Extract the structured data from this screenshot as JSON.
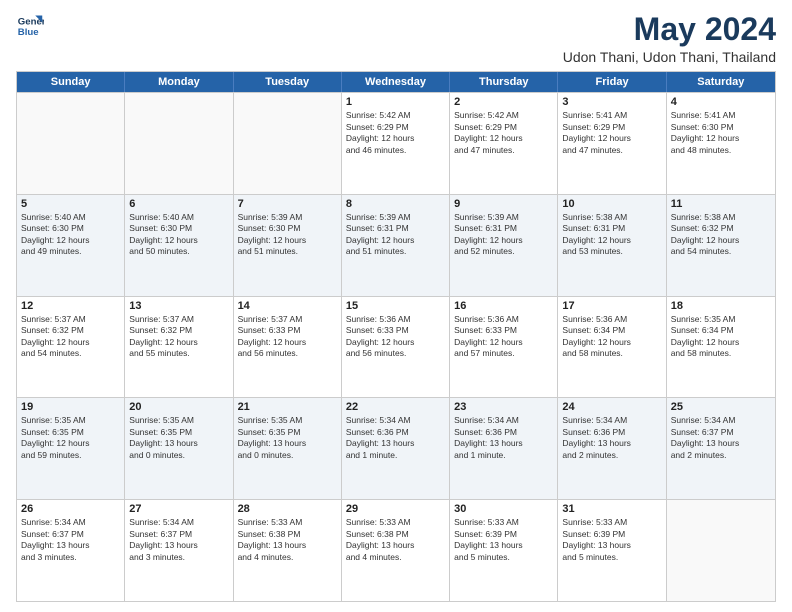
{
  "logo": {
    "line1": "General",
    "line2": "Blue"
  },
  "title": "May 2024",
  "subtitle": "Udon Thani, Udon Thani, Thailand",
  "days": [
    "Sunday",
    "Monday",
    "Tuesday",
    "Wednesday",
    "Thursday",
    "Friday",
    "Saturday"
  ],
  "weeks": [
    [
      {
        "day": "",
        "text": ""
      },
      {
        "day": "",
        "text": ""
      },
      {
        "day": "",
        "text": ""
      },
      {
        "day": "1",
        "text": "Sunrise: 5:42 AM\nSunset: 6:29 PM\nDaylight: 12 hours\nand 46 minutes."
      },
      {
        "day": "2",
        "text": "Sunrise: 5:42 AM\nSunset: 6:29 PM\nDaylight: 12 hours\nand 47 minutes."
      },
      {
        "day": "3",
        "text": "Sunrise: 5:41 AM\nSunset: 6:29 PM\nDaylight: 12 hours\nand 47 minutes."
      },
      {
        "day": "4",
        "text": "Sunrise: 5:41 AM\nSunset: 6:30 PM\nDaylight: 12 hours\nand 48 minutes."
      }
    ],
    [
      {
        "day": "5",
        "text": "Sunrise: 5:40 AM\nSunset: 6:30 PM\nDaylight: 12 hours\nand 49 minutes."
      },
      {
        "day": "6",
        "text": "Sunrise: 5:40 AM\nSunset: 6:30 PM\nDaylight: 12 hours\nand 50 minutes."
      },
      {
        "day": "7",
        "text": "Sunrise: 5:39 AM\nSunset: 6:30 PM\nDaylight: 12 hours\nand 51 minutes."
      },
      {
        "day": "8",
        "text": "Sunrise: 5:39 AM\nSunset: 6:31 PM\nDaylight: 12 hours\nand 51 minutes."
      },
      {
        "day": "9",
        "text": "Sunrise: 5:39 AM\nSunset: 6:31 PM\nDaylight: 12 hours\nand 52 minutes."
      },
      {
        "day": "10",
        "text": "Sunrise: 5:38 AM\nSunset: 6:31 PM\nDaylight: 12 hours\nand 53 minutes."
      },
      {
        "day": "11",
        "text": "Sunrise: 5:38 AM\nSunset: 6:32 PM\nDaylight: 12 hours\nand 54 minutes."
      }
    ],
    [
      {
        "day": "12",
        "text": "Sunrise: 5:37 AM\nSunset: 6:32 PM\nDaylight: 12 hours\nand 54 minutes."
      },
      {
        "day": "13",
        "text": "Sunrise: 5:37 AM\nSunset: 6:32 PM\nDaylight: 12 hours\nand 55 minutes."
      },
      {
        "day": "14",
        "text": "Sunrise: 5:37 AM\nSunset: 6:33 PM\nDaylight: 12 hours\nand 56 minutes."
      },
      {
        "day": "15",
        "text": "Sunrise: 5:36 AM\nSunset: 6:33 PM\nDaylight: 12 hours\nand 56 minutes."
      },
      {
        "day": "16",
        "text": "Sunrise: 5:36 AM\nSunset: 6:33 PM\nDaylight: 12 hours\nand 57 minutes."
      },
      {
        "day": "17",
        "text": "Sunrise: 5:36 AM\nSunset: 6:34 PM\nDaylight: 12 hours\nand 58 minutes."
      },
      {
        "day": "18",
        "text": "Sunrise: 5:35 AM\nSunset: 6:34 PM\nDaylight: 12 hours\nand 58 minutes."
      }
    ],
    [
      {
        "day": "19",
        "text": "Sunrise: 5:35 AM\nSunset: 6:35 PM\nDaylight: 12 hours\nand 59 minutes."
      },
      {
        "day": "20",
        "text": "Sunrise: 5:35 AM\nSunset: 6:35 PM\nDaylight: 13 hours\nand 0 minutes."
      },
      {
        "day": "21",
        "text": "Sunrise: 5:35 AM\nSunset: 6:35 PM\nDaylight: 13 hours\nand 0 minutes."
      },
      {
        "day": "22",
        "text": "Sunrise: 5:34 AM\nSunset: 6:36 PM\nDaylight: 13 hours\nand 1 minute."
      },
      {
        "day": "23",
        "text": "Sunrise: 5:34 AM\nSunset: 6:36 PM\nDaylight: 13 hours\nand 1 minute."
      },
      {
        "day": "24",
        "text": "Sunrise: 5:34 AM\nSunset: 6:36 PM\nDaylight: 13 hours\nand 2 minutes."
      },
      {
        "day": "25",
        "text": "Sunrise: 5:34 AM\nSunset: 6:37 PM\nDaylight: 13 hours\nand 2 minutes."
      }
    ],
    [
      {
        "day": "26",
        "text": "Sunrise: 5:34 AM\nSunset: 6:37 PM\nDaylight: 13 hours\nand 3 minutes."
      },
      {
        "day": "27",
        "text": "Sunrise: 5:34 AM\nSunset: 6:37 PM\nDaylight: 13 hours\nand 3 minutes."
      },
      {
        "day": "28",
        "text": "Sunrise: 5:33 AM\nSunset: 6:38 PM\nDaylight: 13 hours\nand 4 minutes."
      },
      {
        "day": "29",
        "text": "Sunrise: 5:33 AM\nSunset: 6:38 PM\nDaylight: 13 hours\nand 4 minutes."
      },
      {
        "day": "30",
        "text": "Sunrise: 5:33 AM\nSunset: 6:39 PM\nDaylight: 13 hours\nand 5 minutes."
      },
      {
        "day": "31",
        "text": "Sunrise: 5:33 AM\nSunset: 6:39 PM\nDaylight: 13 hours\nand 5 minutes."
      },
      {
        "day": "",
        "text": ""
      }
    ]
  ]
}
